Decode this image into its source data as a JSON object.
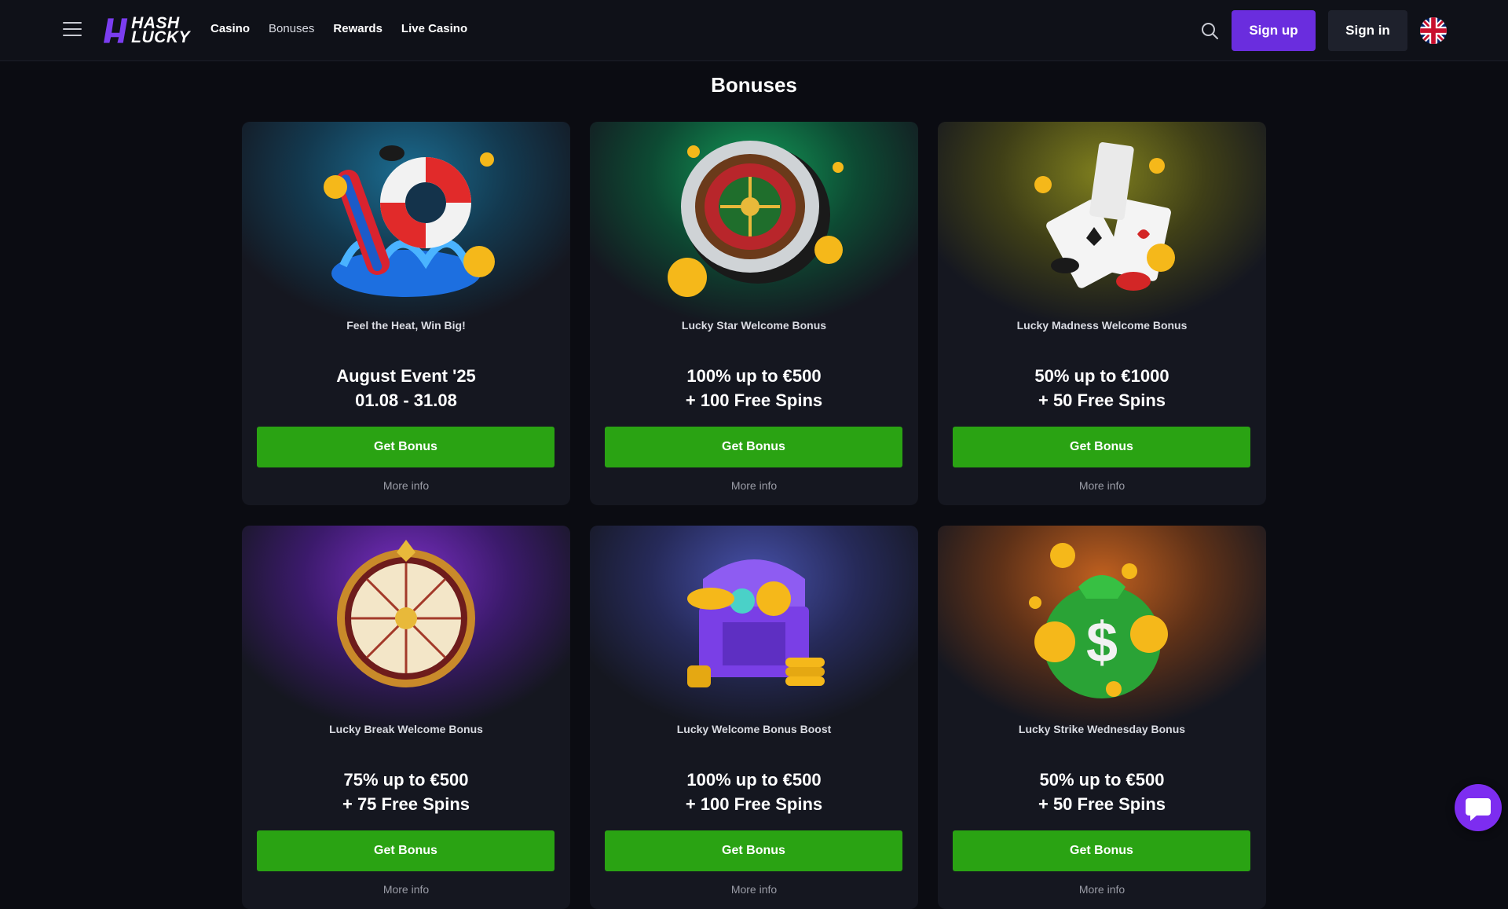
{
  "header": {
    "logo_line1": "HASH",
    "logo_line2": "LUCKY",
    "nav": [
      {
        "label": "Casino"
      },
      {
        "label": "Bonuses"
      },
      {
        "label": "Rewards"
      },
      {
        "label": "Live Casino"
      }
    ],
    "signup_label": "Sign up",
    "signin_label": "Sign in",
    "language_icon": "uk-flag-icon"
  },
  "page": {
    "title": "Bonuses"
  },
  "cards": [
    {
      "subtitle": "Feel the Heat, Win Big!",
      "offer_line1": "August Event '25",
      "offer_line2": "01.08 - 31.08",
      "button": "Get Bonus",
      "more": "More info",
      "art": "beach-ring-icon"
    },
    {
      "subtitle": "Lucky Star Welcome Bonus",
      "offer_line1": "100% up to €500",
      "offer_line2": "+ 100 Free Spins",
      "button": "Get Bonus",
      "more": "More info",
      "art": "roulette-icon"
    },
    {
      "subtitle": "Lucky Madness Welcome Bonus",
      "offer_line1": "50% up to €1000",
      "offer_line2": "+ 50 Free Spins",
      "button": "Get Bonus",
      "more": "More info",
      "art": "playing-cards-icon"
    },
    {
      "subtitle": "Lucky Break Welcome Bonus",
      "offer_line1": "75% up to €500",
      "offer_line2": "+ 75 Free Spins",
      "button": "Get Bonus",
      "more": "More info",
      "art": "fortune-wheel-icon"
    },
    {
      "subtitle": "Lucky Welcome Bonus Boost",
      "offer_line1": "100% up to €500",
      "offer_line2": "+ 100 Free Spins",
      "button": "Get Bonus",
      "more": "More info",
      "art": "treasure-chest-icon"
    },
    {
      "subtitle": "Lucky Strike Wednesday Bonus",
      "offer_line1": "50% up to €500",
      "offer_line2": "+ 50 Free Spins",
      "button": "Get Bonus",
      "more": "More info",
      "art": "money-bag-icon"
    }
  ],
  "colors": {
    "accent_purple": "#6a2dde",
    "button_green": "#2aa313",
    "background": "#0b0c12"
  }
}
